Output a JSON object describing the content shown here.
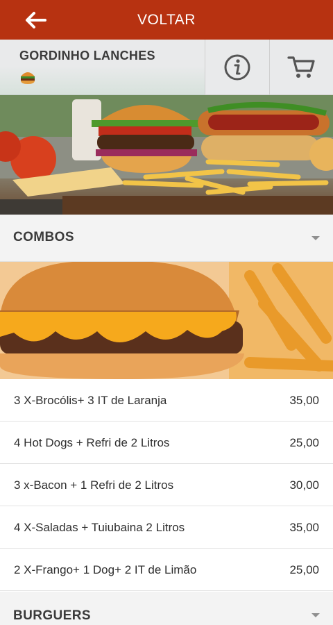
{
  "topbar": {
    "title": "VOLTAR",
    "back_icon": "arrow-left-icon",
    "bg_color": "#b73211"
  },
  "store": {
    "name": "GORDINHO LANCHES",
    "logo_icon": "burger-logo-icon",
    "info_icon": "info-icon",
    "cart_icon": "cart-icon"
  },
  "sections": [
    {
      "title": "COMBOS",
      "items": [
        {
          "name": "3 X-Brocólis+ 3 IT de Laranja",
          "price": "35,00"
        },
        {
          "name": "4 Hot Dogs + Refri de 2 Litros",
          "price": "25,00"
        },
        {
          "name": "3 x-Bacon + 1 Refri de 2 Litros",
          "price": "30,00"
        },
        {
          "name": "4 X-Saladas + Tuiubaina 2 Litros",
          "price": "35,00"
        },
        {
          "name": "2 X-Frango+ 1 Dog+ 2 IT de Limão",
          "price": "25,00"
        }
      ]
    },
    {
      "title": "BURGUERS",
      "items": []
    }
  ]
}
